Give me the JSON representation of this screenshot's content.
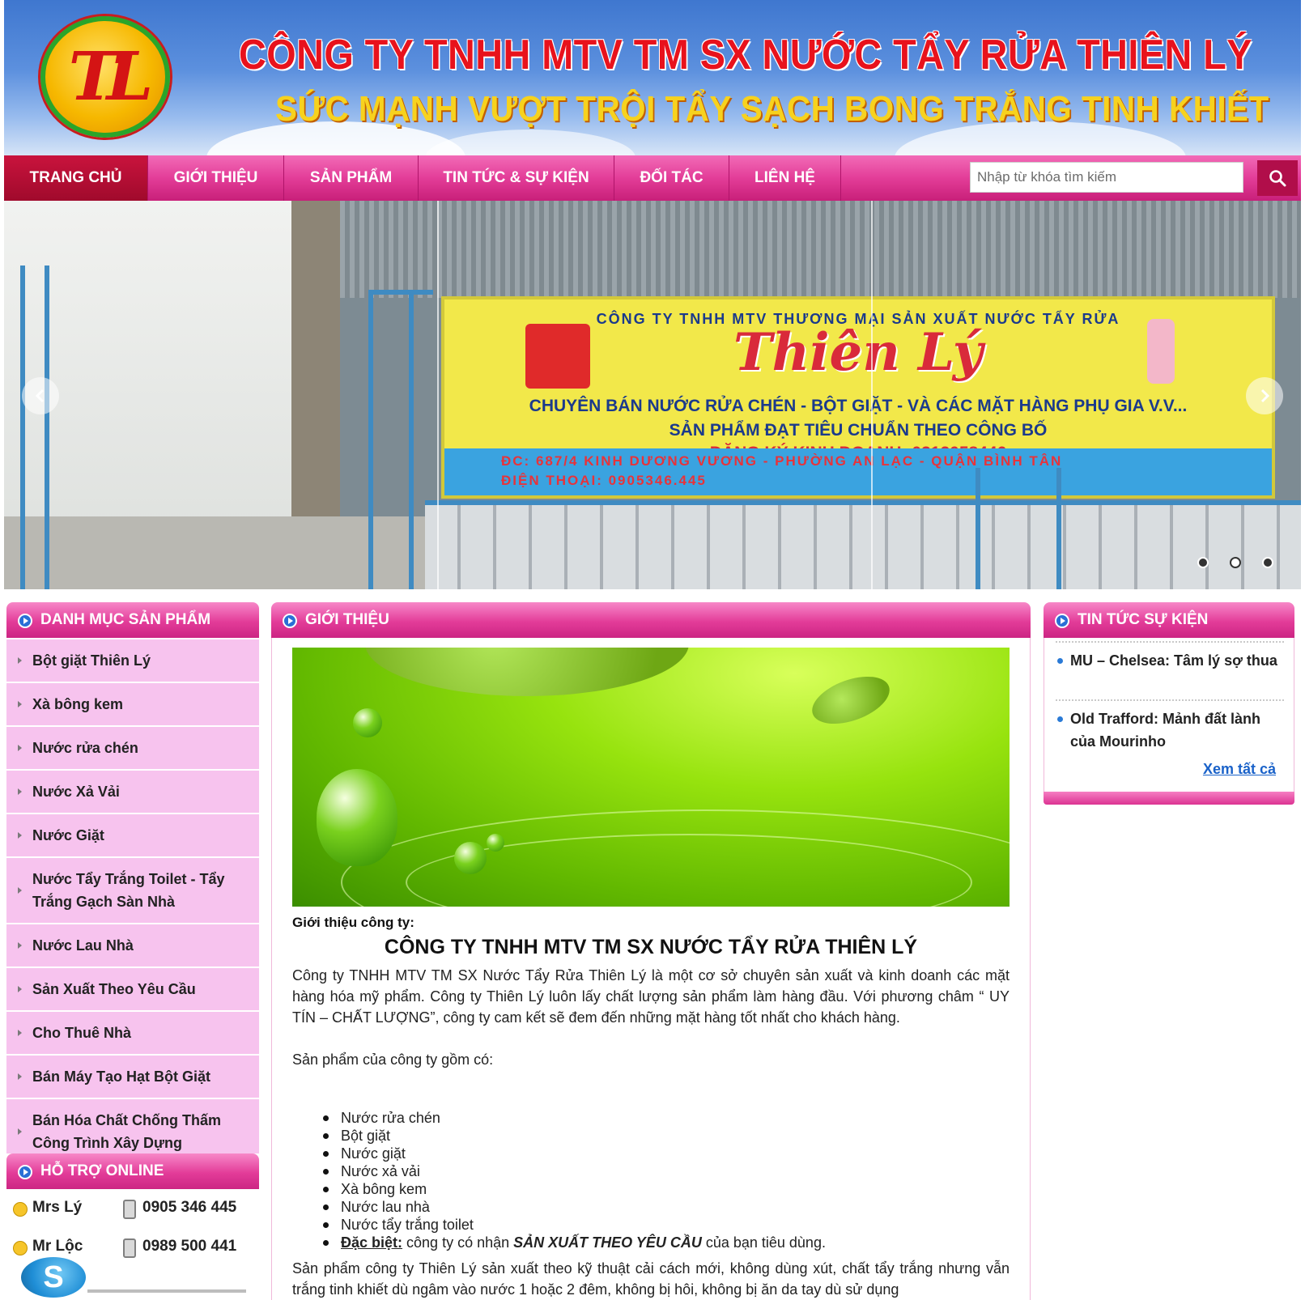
{
  "header": {
    "logo_text": "TL",
    "company_name": "CÔNG TY TNHH MTV TM SX NƯỚC TẨY RỬA THIÊN LÝ",
    "slogan": "SỨC MẠNH VƯỢT TRỘI TẨY SẠCH BONG TRẮNG TINH KHIẾT"
  },
  "nav": {
    "items": [
      "TRANG CHỦ",
      "GIỚI THIỆU",
      "SẢN PHẨM",
      "TIN TỨC & SỰ KIỆN",
      "ĐỐI TÁC",
      "LIÊN HỆ"
    ],
    "active_index": 0,
    "search_placeholder": "Nhập từ khóa tìm kiếm",
    "search_icon": "search-icon"
  },
  "slider": {
    "banner_top": "CÔNG TY TNHH MTV THƯƠNG MẠI SẢN XUẤT NƯỚC TẨY RỬA",
    "banner_brand": "Thiên Lý",
    "banner_line1": "CHUYÊN BÁN NƯỚC RỬA CHÉN - BỘT GIẶT - VÀ CÁC MẶT HÀNG PHỤ GIA V.V...",
    "banner_line2": "SẢN PHẨM ĐẠT TIÊU CHUẨN THEO CÔNG BỐ",
    "banner_line3": "ĐĂNG KÝ KINH DOANH: 0312058446",
    "banner_address": "ĐC: 687/4 KINH DƯƠNG VƯƠNG - PHƯỜNG AN LẠC - QUẬN BÌNH TÂN",
    "banner_phone": "ĐIỆN THOẠI: 0905346.445",
    "dots": 3,
    "active_dot": 1
  },
  "categories": {
    "title": "DANH MỤC SẢN PHẨM",
    "items": [
      "Bột giặt Thiên Lý",
      "Xà bông kem",
      "Nước rửa chén",
      "Nước Xả Vải",
      "Nước Giặt",
      "Nước Tẩy Trắng Toilet - Tẩy Trắng Gạch Sàn Nhà",
      "Nước Lau Nhà",
      "Sản Xuất Theo Yêu Cầu",
      "Cho Thuê Nhà",
      "Bán Máy Tạo Hạt Bột Giặt",
      "Bán Hóa Chất Chống Thấm Công Trình Xây Dựng"
    ]
  },
  "support": {
    "title": "HỖ TRỢ ONLINE",
    "contacts": [
      {
        "name": "Mrs Lý",
        "phone": "0905 346 445"
      },
      {
        "name": "Mr Lộc",
        "phone": "0989 500 441"
      }
    ],
    "skype_letter": "S"
  },
  "main": {
    "title": "GIỚI THIỆU",
    "intro_label": "Giới thiệu công ty:",
    "company_title": "CÔNG TY TNHH MTV TM SX NƯỚC TẨY RỬA THIÊN LÝ",
    "paragraph1": "Công ty TNHH MTV TM SX Nước Tẩy Rửa Thiên Lý là một cơ sở chuyên sản xuất và kinh doanh các mặt hàng hóa mỹ phẩm. Công ty Thiên Lý luôn lấy chất lượng sản phẩm làm hàng đầu. Với phương châm “ UY TÍN – CHẤT LƯỢNG”, công ty cam kết sẽ đem đến những mặt hàng tốt nhất cho khách hàng.",
    "products_intro": "Sản phẩm của công ty gồm có:",
    "products": [
      "Nước rửa chén",
      "Bột giặt",
      "Nước giặt",
      "Nước xả vải",
      "Xà bông kem",
      "Nước lau nhà",
      "Nước tẩy trắng toilet"
    ],
    "special_label": "Đặc biệt:",
    "special_text1": " công ty có nhận ",
    "special_strong": "SẢN XUẤT THEO YÊU CẦU",
    "special_text2": " của bạn tiêu dùng.",
    "paragraph2": "Sản phẩm công ty Thiên  Lý sản xuất theo kỹ thuật cải cách mới, không dùng xút, chất tẩy trắng nhưng vẫn trắng tinh khiết dù ngâm vào nước 1 hoặc 2 đêm, không bị hôi, không bị ăn da tay dù sử dụng"
  },
  "news": {
    "title": "TIN TỨC SỰ KIỆN",
    "items": [
      "MU – Chelsea: Tâm lý sợ thua",
      "Old Trafford: Mảnh đất lành của Mourinho"
    ],
    "see_all": "Xem tất cả"
  },
  "colors": {
    "nav_pink": "#e33d98",
    "nav_active": "#a00a2c",
    "category_bg": "#f7c3ee",
    "title_red": "#e8121c",
    "slogan_yellow": "#f7d21e"
  }
}
